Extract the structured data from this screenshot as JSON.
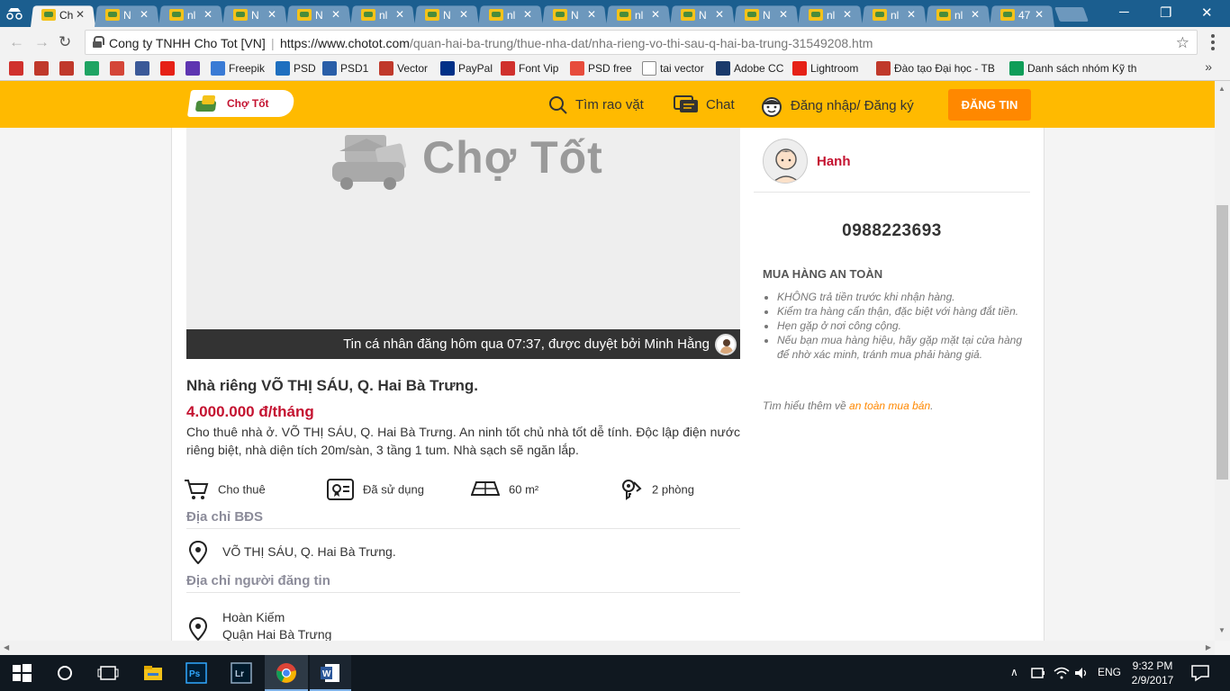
{
  "browser": {
    "tabs": [
      {
        "title": "Ch"
      },
      {
        "title": "N"
      },
      {
        "title": "nl"
      },
      {
        "title": "N"
      },
      {
        "title": "N"
      },
      {
        "title": "nl"
      },
      {
        "title": "N"
      },
      {
        "title": "nl"
      },
      {
        "title": "N"
      },
      {
        "title": "nl"
      },
      {
        "title": "N"
      },
      {
        "title": "N"
      },
      {
        "title": "nl"
      },
      {
        "title": "nl"
      },
      {
        "title": "nl"
      },
      {
        "title": "47"
      }
    ],
    "active_tab_index": 0,
    "site_identity": "Cong ty TNHH Cho Tot [VN]",
    "url_domain": "https://www.chotot.com",
    "url_path": "/quan-hai-ba-trung/thue-nha-dat/nha-rieng-vo-thi-sau-q-hai-ba-trung-31549208.htm",
    "bookmarks": [
      {
        "label": "",
        "icon": "bookmark-icon",
        "color": "#d0312d"
      },
      {
        "label": "",
        "icon": "sict-icon",
        "color": "#c0392b"
      },
      {
        "label": "",
        "icon": "doc-icon",
        "color": "#c0392b"
      },
      {
        "label": "",
        "icon": "drive-icon",
        "color": "#1fa463"
      },
      {
        "label": "",
        "icon": "gmail-icon",
        "color": "#d44638"
      },
      {
        "label": "",
        "icon": "facebook-icon",
        "color": "#3b5998"
      },
      {
        "label": "",
        "icon": "youtube-icon",
        "color": "#e62117"
      },
      {
        "label": "",
        "icon": "list-icon",
        "color": "#5e35b1"
      },
      {
        "label": "Freepik",
        "icon": "freepik-icon",
        "color": "#3a7bd5"
      },
      {
        "label": "PSD",
        "icon": "psd-icon",
        "color": "#1e6fbf"
      },
      {
        "label": "PSD1",
        "icon": "psd1-icon",
        "color": "#2a5fa8"
      },
      {
        "label": "Vector",
        "icon": "vector-icon",
        "color": "#c0392b"
      },
      {
        "label": "PayPal",
        "icon": "paypal-icon",
        "color": "#003087"
      },
      {
        "label": "Font Vip",
        "icon": "fontvip-icon",
        "color": "#d0312d"
      },
      {
        "label": "PSD free",
        "icon": "psdfree-icon",
        "color": "#e74c3c"
      },
      {
        "label": "tai vector",
        "icon": "page-icon",
        "color": "#ffffff"
      },
      {
        "label": "Adobe CC",
        "icon": "adobe-icon",
        "color": "#1a3a6b"
      },
      {
        "label": "Lightroom",
        "icon": "youtube-icon",
        "color": "#e62117"
      },
      {
        "label": "Đào tạo Đại học - TB",
        "icon": "university-icon",
        "color": "#c0392b"
      },
      {
        "label": "Danh sách nhóm Kỹ th",
        "icon": "sheets-icon",
        "color": "#0f9d58"
      }
    ]
  },
  "header": {
    "logo_text": "Chợ Tốt",
    "nav": {
      "search": "Tìm rao vặt",
      "chat": "Chat",
      "login": "Đăng nhập/ Đăng ký"
    },
    "post_button": "ĐĂNG TIN"
  },
  "listing": {
    "placeholder_text": "Chợ Tốt",
    "caption": "Tin cá nhân đăng hôm qua 07:37, được duyệt bởi Minh Hằng",
    "title": "Nhà riêng VÕ THỊ SÁU, Q. Hai Bà Trưng.",
    "price": "4.000.000 đ/tháng",
    "description": "Cho thuê nhà ở. VÕ THỊ SÁU, Q. Hai Bà Trưng. An ninh tốt chủ nhà tốt dễ tính. Độc lập điện nước riêng biệt, nhà diện tích 20m/sàn, 3 tầng 1 tum. Nhà sạch sẽ ngăn lắp.",
    "params": {
      "type": "Cho thuê",
      "condition": "Đã sử dụng",
      "area": "60 m²",
      "rooms": "2 phòng"
    },
    "property_address_heading": "Địa chỉ BĐS",
    "property_address": "VÕ THỊ SÁU, Q. Hai Bà Trưng.",
    "poster_address_heading": "Địa chỉ người đăng tin",
    "poster_address_line1": "Hoàn Kiếm",
    "poster_address_line2": "Quận Hai Bà Trưng"
  },
  "seller": {
    "name": "Hanh",
    "phone": "0988223693",
    "safety_heading": "MUA HÀNG AN TOÀN",
    "safety_tips": [
      "KHÔNG trả tiền trước khi nhận hàng.",
      "Kiểm tra hàng cẩn thận, đặc biệt với hàng đắt tiền.",
      "Hẹn gặp ở nơi công cộng.",
      "Nếu bạn mua hàng hiệu, hãy gặp mặt tại cửa hàng để nhờ xác minh, tránh mua phải hàng giả."
    ],
    "learn_more_prefix": "Tìm hiểu thêm về ",
    "learn_more_link": "an toàn mua bán",
    "learn_more_suffix": "."
  },
  "taskbar": {
    "language": "ENG",
    "time": "9:32 PM",
    "date": "2/9/2017"
  },
  "colors": {
    "brand_yellow": "#ffba00",
    "price_red": "#c41230",
    "post_button_orange": "#ff8800"
  }
}
